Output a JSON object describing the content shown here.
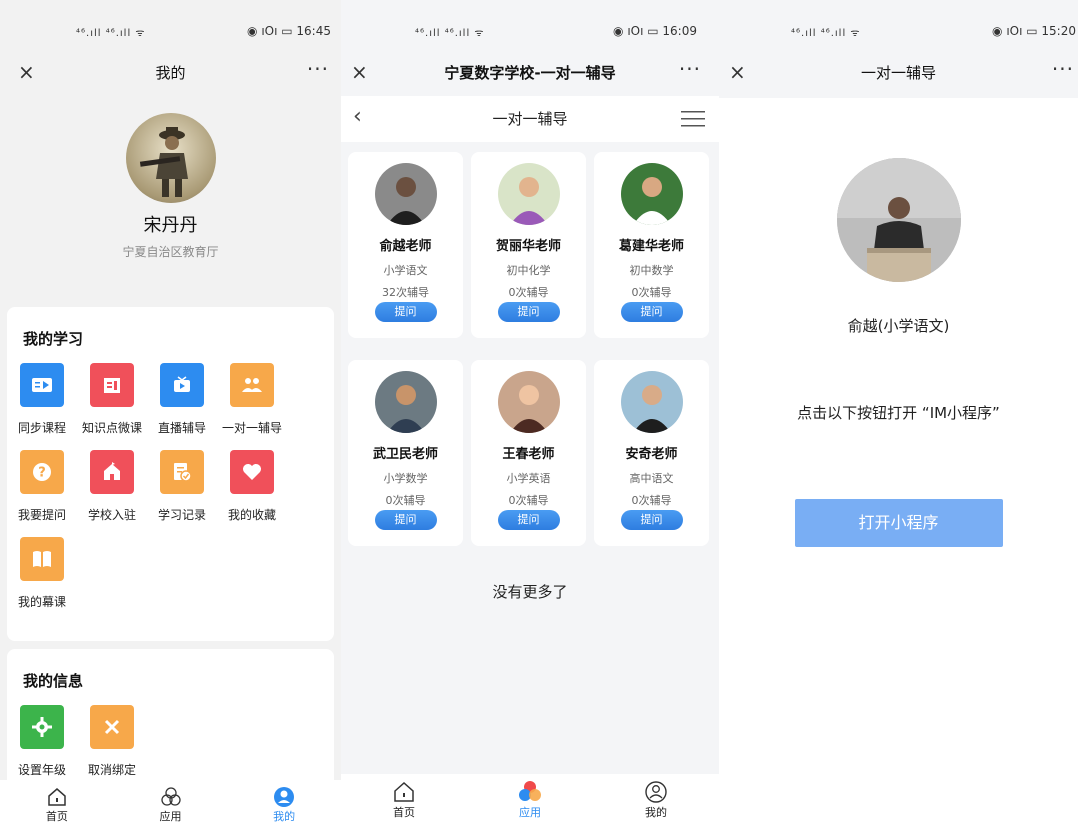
{
  "screen1": {
    "status": {
      "signal": "⁴⁶.ıll ⁴⁶.ıll ᯤ",
      "right": "◉ ıOı ▭ 16:45"
    },
    "title": "我的",
    "user": {
      "name": "宋丹丹",
      "org": "宁夏自治区教育厅"
    },
    "study": {
      "title": "我的学习",
      "items": [
        {
          "label": "同步课程",
          "color": "#2d8cf0",
          "icon": "video-icon"
        },
        {
          "label": "知识点微课",
          "color": "#f0505a",
          "icon": "film-icon"
        },
        {
          "label": "直播辅导",
          "color": "#2d8cf0",
          "icon": "tv-play-icon"
        },
        {
          "label": "一对一辅导",
          "color": "#f7a84a",
          "icon": "people-icon"
        },
        {
          "label": "我要提问",
          "color": "#f7a84a",
          "icon": "question-icon"
        },
        {
          "label": "学校入驻",
          "color": "#f0505a",
          "icon": "school-icon"
        },
        {
          "label": "学习记录",
          "color": "#f7a84a",
          "icon": "record-icon"
        },
        {
          "label": "我的收藏",
          "color": "#f0505a",
          "icon": "heart-icon"
        },
        {
          "label": "我的幕课",
          "color": "#f7a84a",
          "icon": "book-icon"
        }
      ]
    },
    "info": {
      "title": "我的信息",
      "items": [
        {
          "label": "设置年级",
          "color": "#3cb44b",
          "icon": "gear-icon"
        },
        {
          "label": "取消绑定",
          "color": "#f7a84a",
          "icon": "close-icon"
        }
      ]
    },
    "tabs": [
      "首页",
      "应用",
      "我的"
    ]
  },
  "screen2": {
    "status": {
      "signal": "⁴⁶.ıll ⁴⁶.ıll ᯤ",
      "right": "◉ ıOı ▭ 16:09"
    },
    "title": "宁夏数字学校-一对一辅导",
    "subtitle": "一对一辅导",
    "ask_label": "提问",
    "teachers": [
      {
        "name": "俞越老师",
        "subject": "小学语文",
        "count": "32次辅导"
      },
      {
        "name": "贺丽华老师",
        "subject": "初中化学",
        "count": "0次辅导"
      },
      {
        "name": "葛建华老师",
        "subject": "初中数学",
        "count": "0次辅导"
      },
      {
        "name": "武卫民老师",
        "subject": "小学数学",
        "count": "0次辅导"
      },
      {
        "name": "王春老师",
        "subject": "小学英语",
        "count": "0次辅导"
      },
      {
        "name": "安奇老师",
        "subject": "高中语文",
        "count": "0次辅导"
      }
    ],
    "no_more": "没有更多了",
    "tabs": [
      "首页",
      "应用",
      "我的"
    ]
  },
  "screen3": {
    "status": {
      "signal": "⁴⁶.ıll ⁴⁶.ıll ᯤ",
      "right": "◉ ıOı ▭ 15:20"
    },
    "title": "一对一辅导",
    "teacher": "俞越(小学语文)",
    "hint": "点击以下按钮打开 “IM小程序”",
    "button": "打开小程序"
  },
  "colors": {
    "accent": "#2d8cf0",
    "button_light": "#79aef4",
    "ask_blue": "#2e7de0"
  }
}
